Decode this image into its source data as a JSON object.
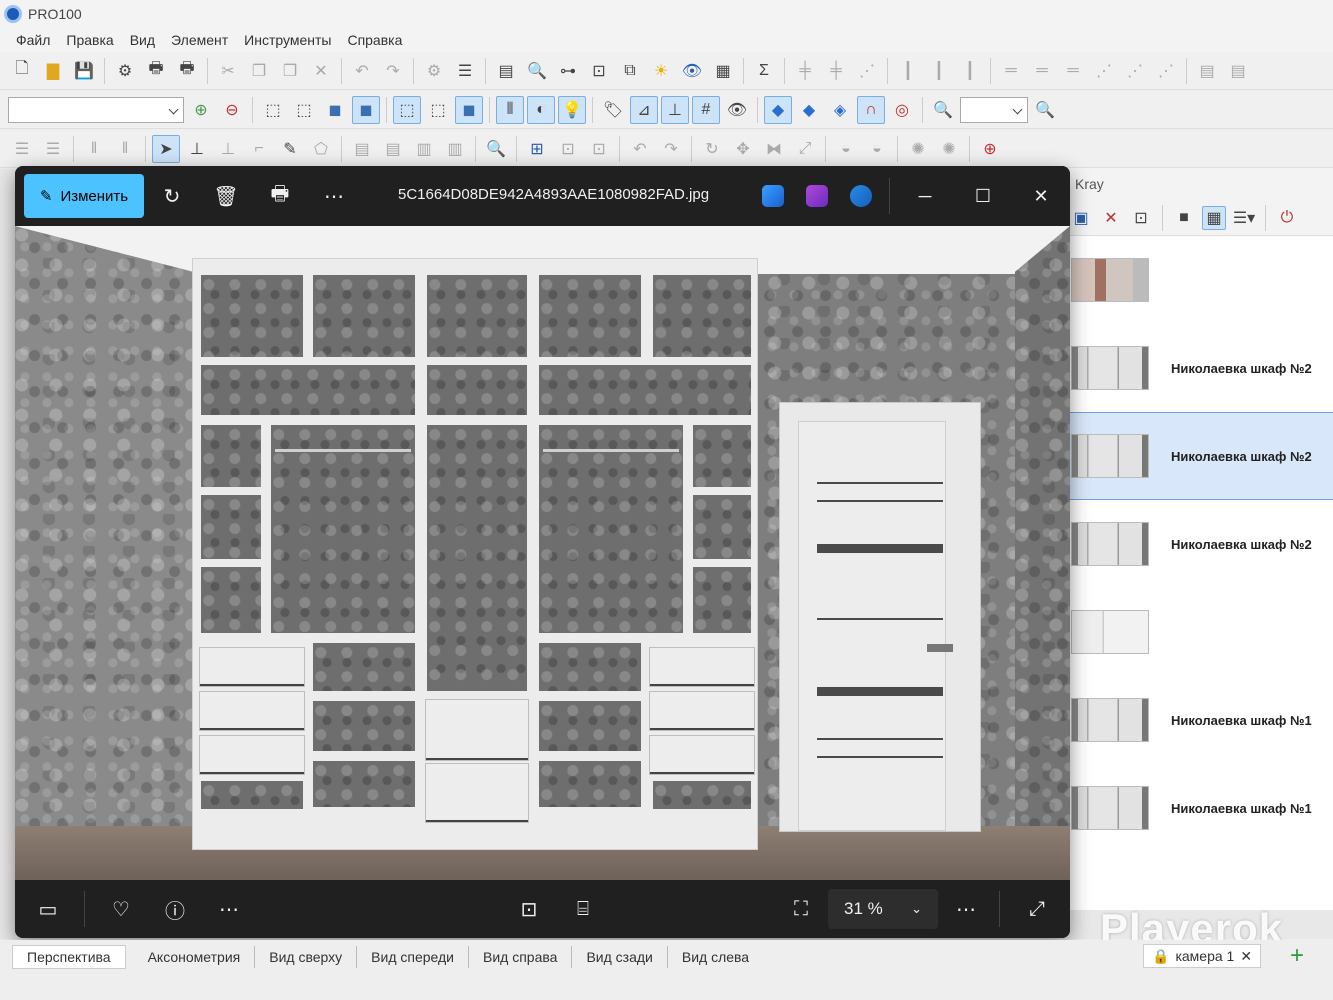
{
  "app": {
    "title": "PRO100",
    "accent": "#1e5bb8"
  },
  "menu": [
    "Файл",
    "Правка",
    "Вид",
    "Элемент",
    "Инструменты",
    "Справка"
  ],
  "viewer": {
    "edit_label": "Изменить",
    "filename": "5C1664D08DE942A4893AAE1080982FAD.jpg",
    "zoom": "31 %",
    "accent": "#4cc2ff"
  },
  "side_panel": {
    "title": "Kray",
    "items": [
      {
        "label": ""
      },
      {
        "label": "Николаевка шкаф №2"
      },
      {
        "label": "Николаевка шкаф №2",
        "selected": true
      },
      {
        "label": "Николаевка шкаф №2"
      },
      {
        "label": ""
      },
      {
        "label": "Николаевка шкаф №1"
      },
      {
        "label": "Николаевка шкаф №1"
      }
    ]
  },
  "view_tabs": [
    "Перспектива",
    "Аксонометрия",
    "Вид сверху",
    "Вид спереди",
    "Вид справа",
    "Вид сзади",
    "Вид слева"
  ],
  "camera_tab": "камера 1",
  "watermark": "Playerok"
}
